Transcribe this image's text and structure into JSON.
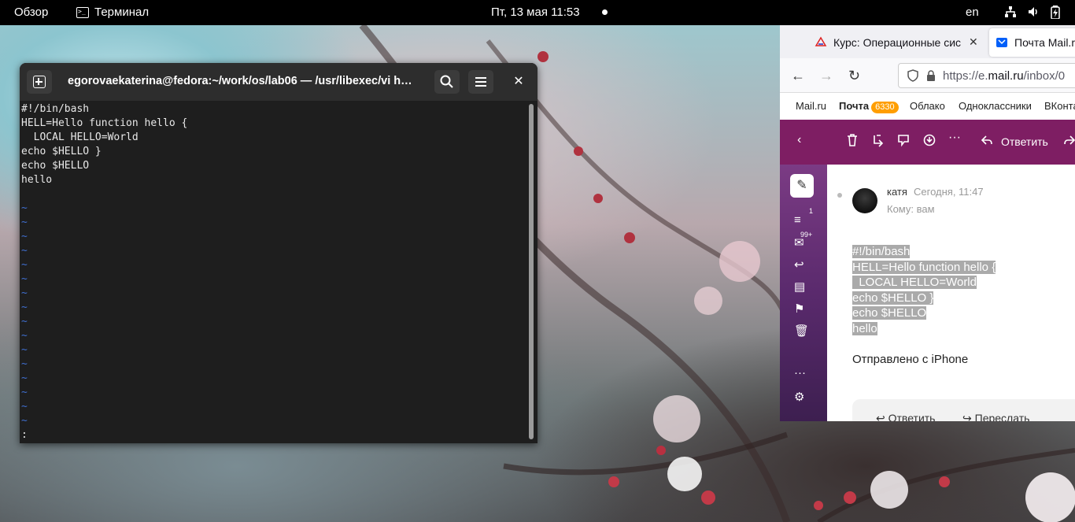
{
  "topbar": {
    "overview": "Обзор",
    "app_name": "Терминал",
    "clock": "Пт, 13 мая  11:53",
    "lang": "en"
  },
  "terminal": {
    "title": "egorovaekaterina@fedora:~/work/os/lab06 — /usr/libexec/vi h…",
    "lines": [
      "#!/bin/bash",
      "HELL=Hello function hello {",
      "  LOCAL HELLO=World",
      "echo $HELLO }",
      "echo $HELLO",
      "hello"
    ],
    "tilde_count": 16,
    "prompt": ":"
  },
  "browser": {
    "tab1_label": "Курс: Операционные сис",
    "tab2_label": "Почта Mail.r",
    "url_prefix": "https://e.",
    "url_domain": "mail.ru",
    "url_suffix": "/inbox/0",
    "bookmarks": [
      "Mail.ru",
      "Почта",
      "Облако",
      "Одноклассники",
      "ВКонта"
    ],
    "mail_badge": "6330",
    "toolbar_reply": "Ответить",
    "sidebar_badge1": "1",
    "sidebar_badge2": "99+",
    "message": {
      "sender": "катя",
      "date": "Сегодня, 11:47",
      "to": "Кому:  вам",
      "body": [
        "#!/bin/bash",
        "HELL=Hello function hello {",
        "  LOCAL HELLO=World",
        "echo $HELLO }",
        "echo $HELLO",
        "hello"
      ],
      "signature": "Отправлено с iPhone",
      "reply": "Ответить",
      "forward": "Переслать"
    }
  }
}
